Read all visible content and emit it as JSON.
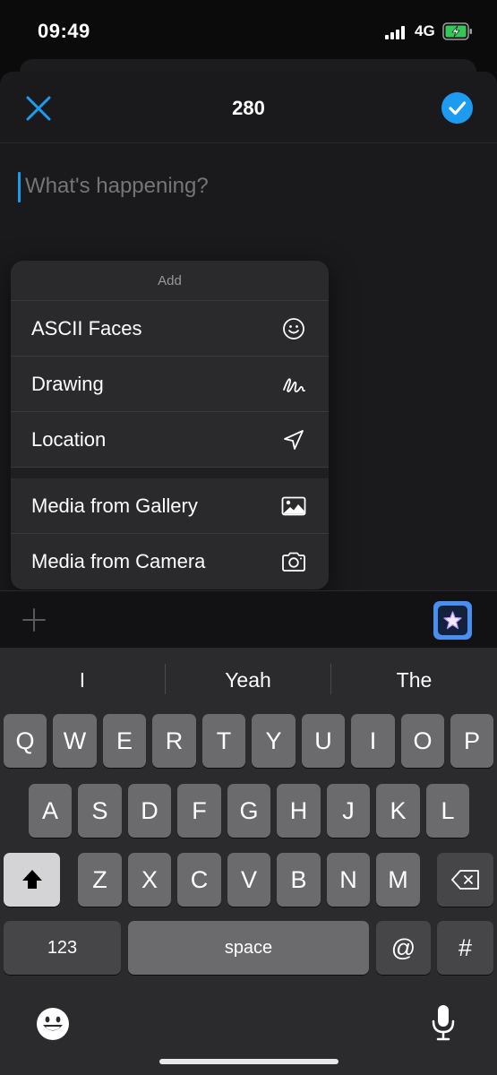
{
  "status": {
    "time": "09:49",
    "network": "4G"
  },
  "composer": {
    "char_count": "280",
    "placeholder": "What's happening?"
  },
  "menu": {
    "header": "Add",
    "items": [
      {
        "label": "ASCII Faces",
        "icon": "smiley-icon"
      },
      {
        "label": "Drawing",
        "icon": "scribble-icon"
      },
      {
        "label": "Location",
        "icon": "location-arrow-icon"
      },
      {
        "label": "Media from Gallery",
        "icon": "image-icon"
      },
      {
        "label": "Media from Camera",
        "icon": "camera-icon"
      }
    ]
  },
  "suggestions": [
    "I",
    "Yeah",
    "The"
  ],
  "keyboard": {
    "row1": [
      "Q",
      "W",
      "E",
      "R",
      "T",
      "Y",
      "U",
      "I",
      "O",
      "P"
    ],
    "row2": [
      "A",
      "S",
      "D",
      "F",
      "G",
      "H",
      "J",
      "K",
      "L"
    ],
    "row3": [
      "Z",
      "X",
      "C",
      "V",
      "B",
      "N",
      "M"
    ],
    "numbers_label": "123",
    "space_label": "space",
    "at_label": "@",
    "hash_label": "#"
  },
  "colors": {
    "accent": "#1d9bf0",
    "background": "#1a1a1c",
    "keyboard": "#2b2b2d"
  }
}
